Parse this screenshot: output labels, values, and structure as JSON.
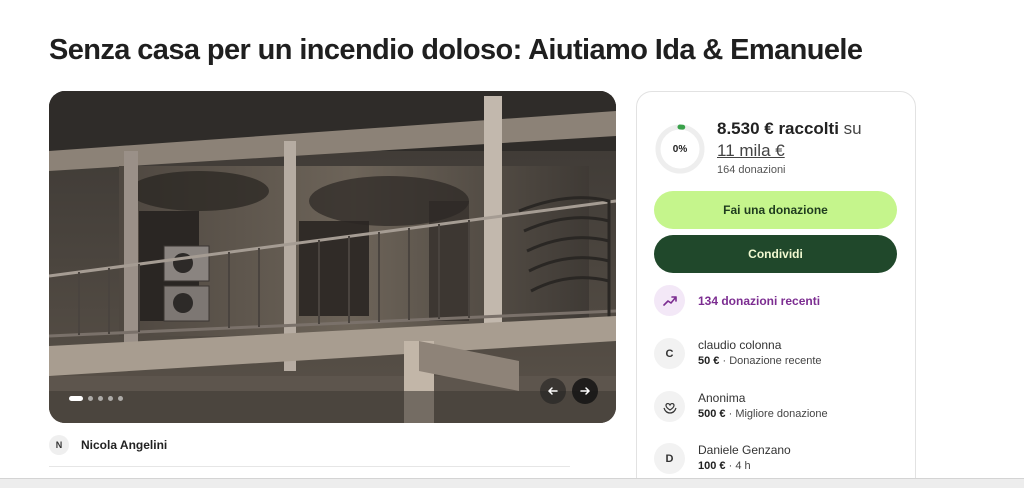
{
  "page": {
    "title": "Senza casa per un incendio doloso: Aiutiamo Ida & Emanuele"
  },
  "gallery": {
    "image_description": "burned-apartment-balcony",
    "dots_count": 5,
    "active_dot": 0,
    "prev_icon": "arrow-left-icon",
    "next_icon": "arrow-right-icon"
  },
  "organizer": {
    "initial": "N",
    "name": "Nicola Angelini"
  },
  "donation_card": {
    "progress_percent_label": "0%",
    "progress_fraction": 0.02,
    "raised_amount": "8.530 € raccolti",
    "of_word": "su",
    "goal": "11 mila €",
    "donations_count": "164 donazioni",
    "donate_button": "Fai una donazione",
    "share_button": "Condividi",
    "recent_label": "134 donazioni recenti",
    "recent_icon": "trending-up-icon",
    "donors": [
      {
        "initial": "C",
        "name": "claudio colonna",
        "amount": "50 €",
        "note": "· Donazione recente"
      },
      {
        "icon": "heart-hands-icon",
        "name": "Anonima",
        "amount": "500 €",
        "note": "· Migliore donazione"
      },
      {
        "initial": "D",
        "name": "Daniele Genzano",
        "amount": "100 €",
        "note": "· 4 h"
      }
    ]
  },
  "colors": {
    "donate_bg": "#c5f58c",
    "share_bg": "#20482b",
    "accent_purple": "#7c2d91",
    "progress_green": "#39a14a"
  }
}
